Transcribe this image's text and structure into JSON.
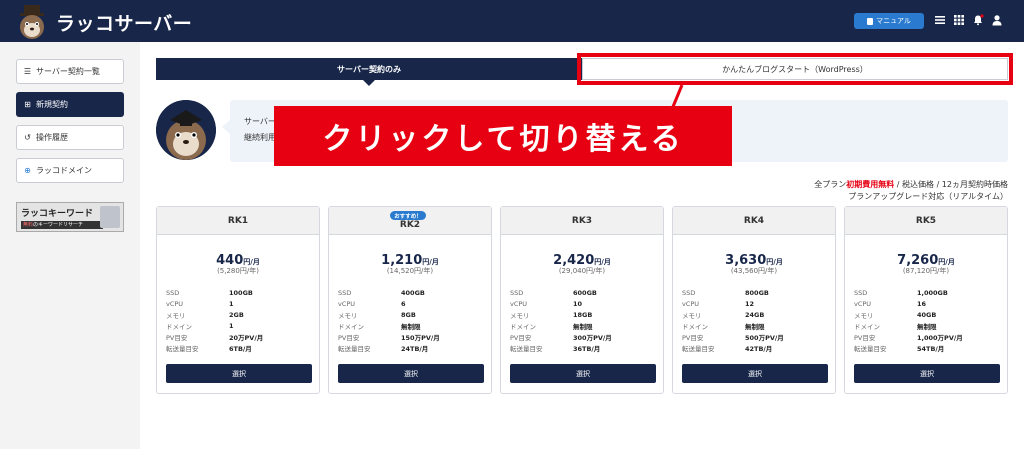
{
  "header": {
    "app_name": "ラッコサーバー",
    "manual_label": "マニュアル"
  },
  "sidebar": {
    "items": [
      {
        "label": "サーバー契約一覧",
        "icon": "list-icon"
      },
      {
        "label": "新規契約",
        "icon": "plus-square-icon",
        "active": true
      },
      {
        "label": "操作履歴",
        "icon": "history-icon"
      },
      {
        "label": "ラッコドメイン",
        "icon": "globe-icon"
      }
    ],
    "banner": {
      "title": "ラッコキーワード",
      "sub_highlight": "無料",
      "sub_rest": "のキーワードリサーチ"
    }
  },
  "tabs": [
    {
      "label": "サーバー契約のみ",
      "active": true
    },
    {
      "label": "かんたんブログスタート（WordPress）",
      "active": false
    }
  ],
  "info": {
    "line1": "サーバー",
    "line2": "継続利用"
  },
  "callout": "クリックして切り替える",
  "note": {
    "prefix": "全プラン",
    "highlight": "初期費用無料",
    "suffix": " / 税込価格 / 12ヵ月契約時価格",
    "line2": "プランアップグレード対応（リアルタイム）"
  },
  "spec_labels": {
    "ssd": "SSD",
    "vcpu": "vCPU",
    "memory": "メモリ",
    "domain": "ドメイン",
    "pv": "PV目安",
    "transfer": "転送量目安"
  },
  "select_label": "選択",
  "recommended_label": "おすすめ！",
  "plans": [
    {
      "name": "RK1",
      "price": "440",
      "unit": "円/月",
      "yearly": "(5,280円/年)",
      "ssd": "100GB",
      "vcpu": "1",
      "memory": "2GB",
      "domain": "1",
      "pv": "20万PV/月",
      "transfer": "6TB/月"
    },
    {
      "name": "RK2",
      "price": "1,210",
      "unit": "円/月",
      "yearly": "(14,520円/年)",
      "ssd": "400GB",
      "vcpu": "6",
      "memory": "8GB",
      "domain": "無制限",
      "pv": "150万PV/月",
      "transfer": "24TB/月",
      "recommended": true
    },
    {
      "name": "RK3",
      "price": "2,420",
      "unit": "円/月",
      "yearly": "(29,040円/年)",
      "ssd": "600GB",
      "vcpu": "10",
      "memory": "18GB",
      "domain": "無制限",
      "pv": "300万PV/月",
      "transfer": "36TB/月"
    },
    {
      "name": "RK4",
      "price": "3,630",
      "unit": "円/月",
      "yearly": "(43,560円/年)",
      "ssd": "800GB",
      "vcpu": "12",
      "memory": "24GB",
      "domain": "無制限",
      "pv": "500万PV/月",
      "transfer": "42TB/月"
    },
    {
      "name": "RK5",
      "price": "7,260",
      "unit": "円/月",
      "yearly": "(87,120円/年)",
      "ssd": "1,000GB",
      "vcpu": "16",
      "memory": "40GB",
      "domain": "無制限",
      "pv": "1,000万PV/月",
      "transfer": "54TB/月"
    }
  ],
  "colors": {
    "navy": "#18264a",
    "accent_blue": "#2a7bd0",
    "red": "#e60012"
  }
}
